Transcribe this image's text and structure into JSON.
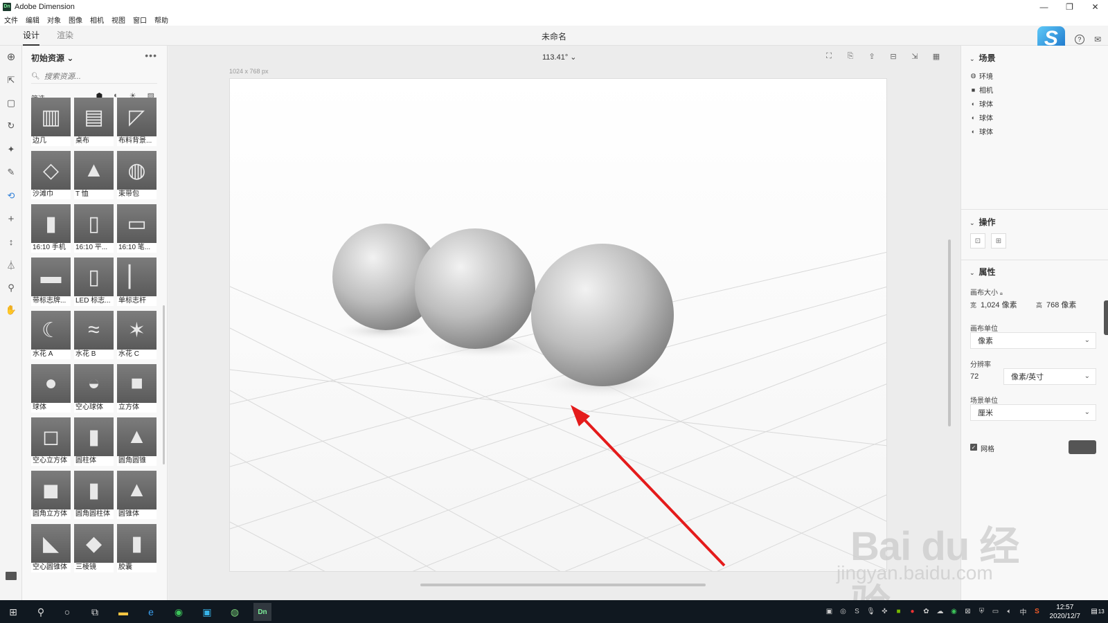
{
  "window": {
    "app_title": "Adobe Dimension",
    "logo_text": "Dn"
  },
  "menu": [
    "文件",
    "编辑",
    "对象",
    "图像",
    "相机",
    "视图",
    "窗口",
    "帮助"
  ],
  "tabs": {
    "design": "设计",
    "render": "渲染"
  },
  "doc_title": "未命名",
  "assets": {
    "title": "初始资源",
    "search_placeholder": "搜索资源...",
    "filter_label": "筛选",
    "items": [
      "边几",
      "桌布",
      "布料背景...",
      "沙滩巾",
      "T 恤",
      "束带包",
      "16:10 手机",
      "16:10 平...",
      "16:10 笔...",
      "带标志牌...",
      "LED 标志...",
      "单标志杆",
      "水花 A",
      "水花 B",
      "水花 C",
      "球体",
      "空心球体",
      "立方体",
      "空心立方体",
      "圆柱体",
      "圆角圆锥",
      "圆角立方体",
      "圆角圆柱体",
      "圆锥体",
      "空心圆锥体",
      "三棱镜",
      "胶囊"
    ]
  },
  "viewport": {
    "zoom": "113.41°",
    "canvas_size_label": "1024 x 768 px"
  },
  "scene": {
    "title": "场景",
    "items": [
      {
        "icon": "environment-icon",
        "label": "环境"
      },
      {
        "icon": "camera-icon",
        "label": "相机"
      },
      {
        "icon": "sphere-icon",
        "label": "球体"
      },
      {
        "icon": "sphere-icon",
        "label": "球体"
      },
      {
        "icon": "sphere-icon",
        "label": "球体"
      }
    ]
  },
  "actions": {
    "title": "操作"
  },
  "properties": {
    "title": "属性",
    "canvas_size_label": "画布大小",
    "width_prefix": "宽",
    "width_value": "1,024 像素",
    "height_prefix": "高",
    "height_value": "768 像素",
    "canvas_unit_label": "画布单位",
    "canvas_unit_value": "像素",
    "resolution_label": "分辨率",
    "resolution_value": "72",
    "resolution_unit": "像素/英寸",
    "scene_unit_label": "场景单位",
    "scene_unit_value": "厘米",
    "grid_label": "网格",
    "grid_checked": true,
    "grid_color": "#555555"
  },
  "watermark": {
    "main": "Bai du 经验",
    "sub": "jingyan.baidu.com"
  },
  "taskbar": {
    "time": "12:57",
    "date": "2020/12/7",
    "ime": "中",
    "notification_count": "13"
  }
}
